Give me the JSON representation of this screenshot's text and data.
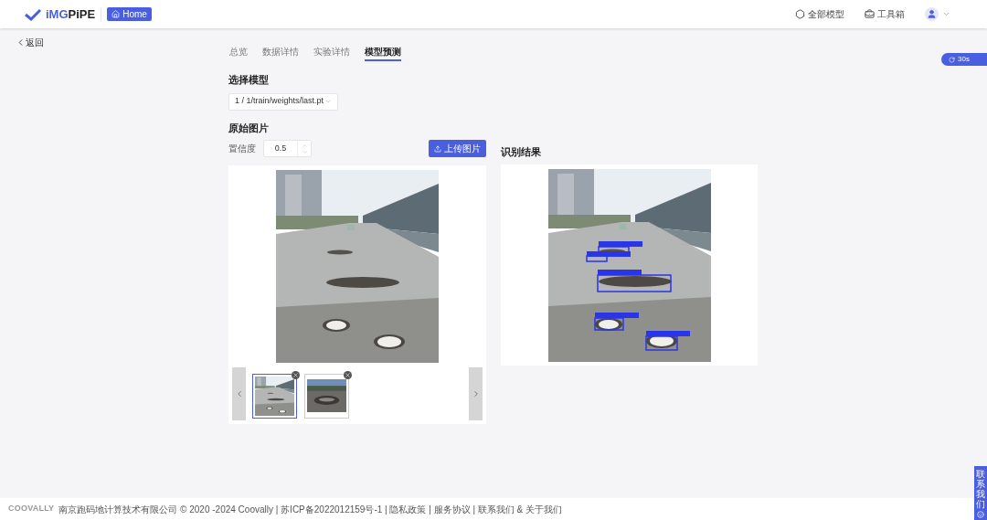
{
  "header": {
    "logo": {
      "accent": "iMG",
      "rest": "PiPE"
    },
    "home_button": "Home",
    "nav": [
      {
        "label": "全部模型",
        "kind": "models"
      },
      {
        "label": "工具箱",
        "kind": "toolbox"
      }
    ]
  },
  "back_link": "返回",
  "timer_badge": "30s",
  "tabs": [
    {
      "label": "总览",
      "selected": false
    },
    {
      "label": "数据详情",
      "selected": false
    },
    {
      "label": "实验详情",
      "selected": false
    },
    {
      "label": "模型预测",
      "selected": true
    }
  ],
  "model_section": {
    "title": "选择模型",
    "select_value": "1 / 1/train/weights/last.pt"
  },
  "original": {
    "title": "原始图片",
    "confidence_label": "置信度",
    "confidence_value": "0.5",
    "upload_button": "上传图片",
    "thumbnails": [
      {
        "selected": true
      },
      {
        "selected": false
      }
    ]
  },
  "result": {
    "title": "识别结果"
  },
  "contact_tab": "联系我们",
  "footer": {
    "brand": "COOVALLY",
    "text": "南京跑码地计算技术有限公司 © 2020 -2024 Coovally | 苏ICP备2022012159号-1 | 隐私政策 | 服务协议 | 联系我们 & 关于我们"
  }
}
